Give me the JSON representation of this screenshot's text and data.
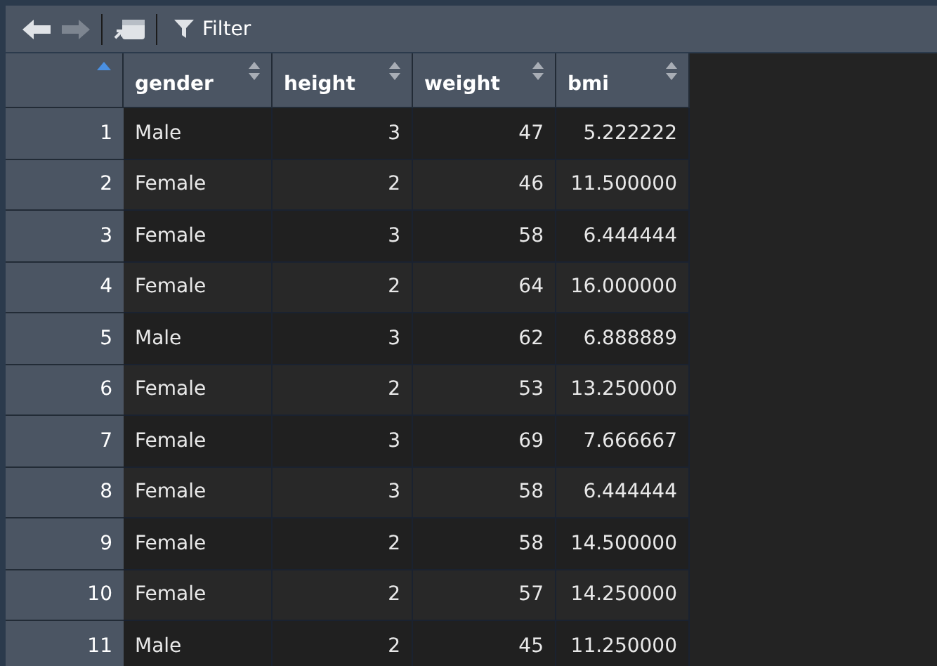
{
  "toolbar": {
    "back": {
      "disabled": false
    },
    "forward": {
      "disabled": true
    },
    "filter": {
      "label": "Filter"
    }
  },
  "table": {
    "index_sorted": true,
    "columns": [
      {
        "label": "gender",
        "kind": "text",
        "sorted": false
      },
      {
        "label": "height",
        "kind": "number",
        "sorted": false
      },
      {
        "label": "weight",
        "kind": "number",
        "sorted": false
      },
      {
        "label": "bmi",
        "kind": "number",
        "sorted": false
      }
    ],
    "rows": [
      {
        "index": "1",
        "cells": [
          "Male",
          "3",
          "47",
          "5.222222"
        ]
      },
      {
        "index": "2",
        "cells": [
          "Female",
          "2",
          "46",
          "11.500000"
        ]
      },
      {
        "index": "3",
        "cells": [
          "Female",
          "3",
          "58",
          "6.444444"
        ]
      },
      {
        "index": "4",
        "cells": [
          "Female",
          "2",
          "64",
          "16.000000"
        ]
      },
      {
        "index": "5",
        "cells": [
          "Male",
          "3",
          "62",
          "6.888889"
        ]
      },
      {
        "index": "6",
        "cells": [
          "Female",
          "2",
          "53",
          "13.250000"
        ]
      },
      {
        "index": "7",
        "cells": [
          "Female",
          "3",
          "69",
          "7.666667"
        ]
      },
      {
        "index": "8",
        "cells": [
          "Female",
          "3",
          "58",
          "6.444444"
        ]
      },
      {
        "index": "9",
        "cells": [
          "Female",
          "2",
          "58",
          "14.500000"
        ]
      },
      {
        "index": "10",
        "cells": [
          "Female",
          "2",
          "57",
          "14.250000"
        ]
      },
      {
        "index": "11",
        "cells": [
          "Male",
          "2",
          "45",
          "11.250000"
        ]
      }
    ]
  }
}
